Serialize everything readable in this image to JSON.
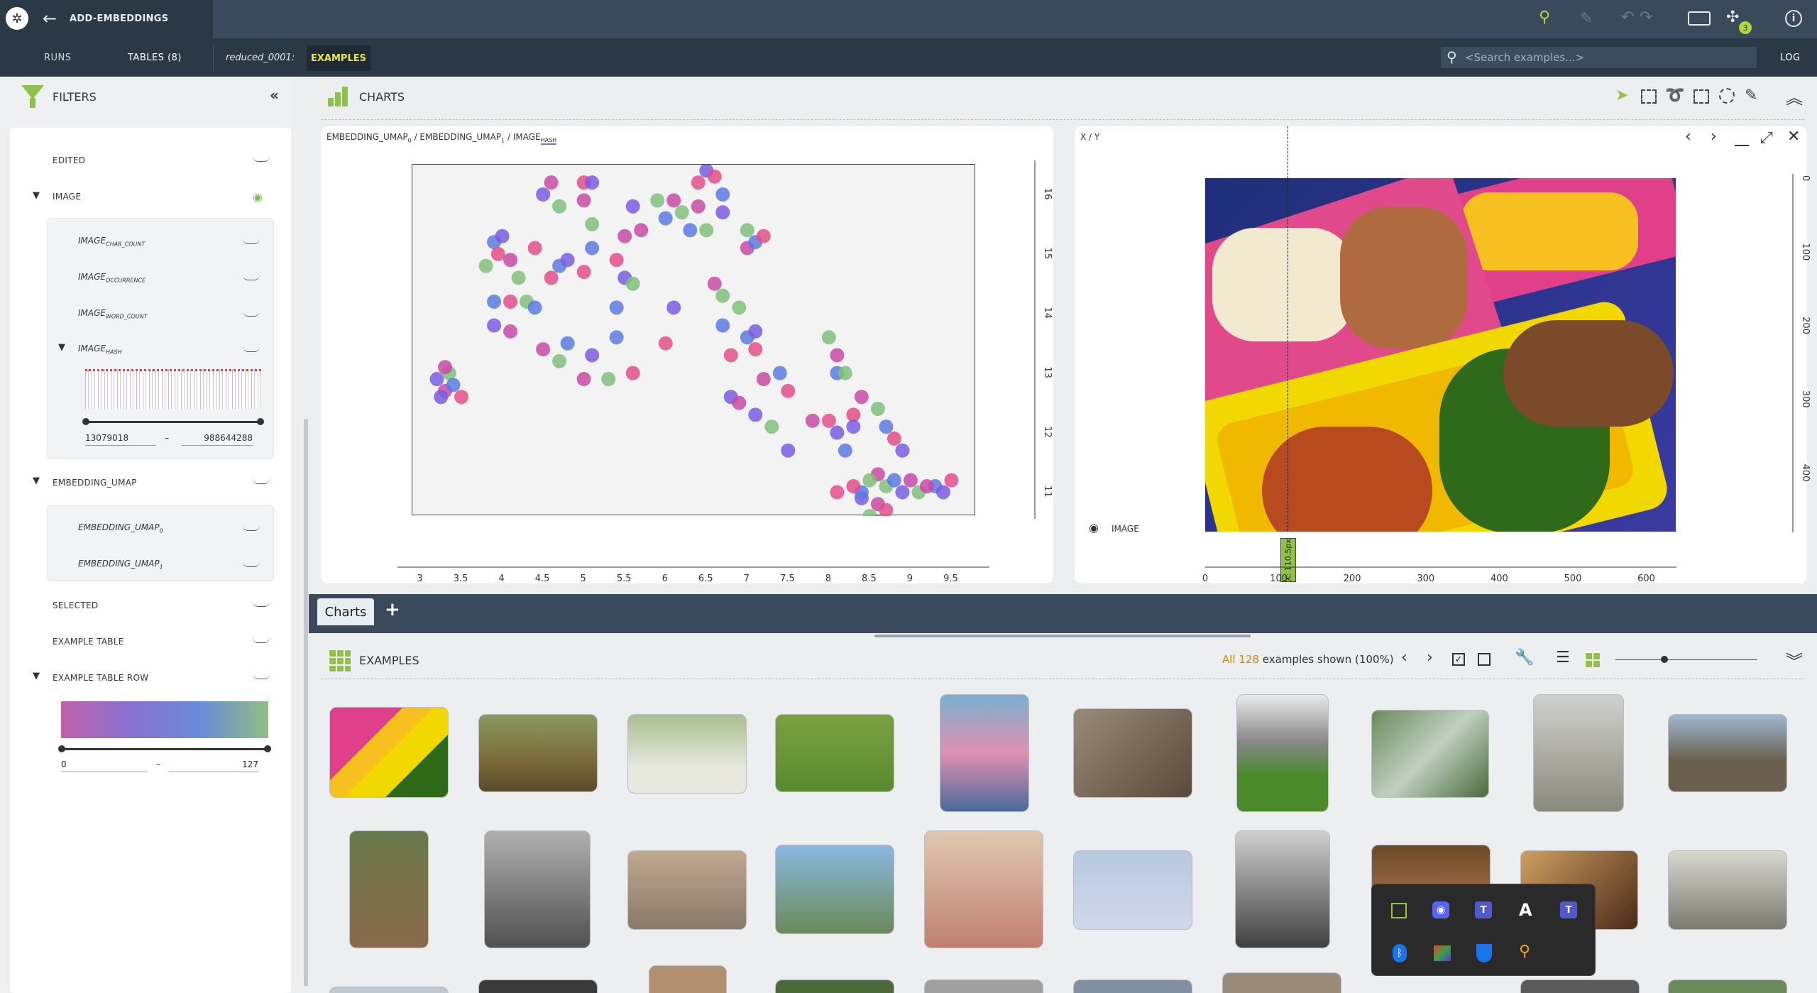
{
  "app": {
    "title": "ADD-EMBEDDINGS",
    "notif_count": "3"
  },
  "nav": {
    "runs": "RUNS",
    "tables": "TABLES (8)",
    "dataset": "reduced_0001:",
    "examples": "EXAMPLES",
    "search_placeholder": "<Search examples...>",
    "log": "LOG"
  },
  "filters": {
    "title": "FILTERS",
    "edited": "EDITED",
    "image": "IMAGE",
    "image_char_count": "IMAGE",
    "image_char_count_sub": "CHAR_COUNT",
    "image_occurrence": "IMAGE",
    "image_occurrence_sub": "OCCURRENCE",
    "image_word_count": "IMAGE",
    "image_word_count_sub": "WORD_COUNT",
    "image_hash": "IMAGE",
    "image_hash_sub": "HASH",
    "hash_min": "13079018",
    "hash_max": "988644288",
    "range_sep": "–",
    "embedding_umap": "EMBEDDING_UMAP",
    "embedding_umap0": "EMBEDDING_UMAP",
    "embedding_umap0_sub": "0",
    "embedding_umap1": "EMBEDDING_UMAP",
    "embedding_umap1_sub": "1",
    "selected": "SELECTED",
    "example_table": "EXAMPLE TABLE",
    "example_table_row": "EXAMPLE TABLE ROW",
    "row_min": "0",
    "row_max": "127"
  },
  "charts": {
    "title": "CHARTS",
    "scatter_title_a": "EMBEDDING_UMAP",
    "scatter_title_a_sub": "0",
    "scatter_title_b": "/ EMBEDDING_UMAP",
    "scatter_title_b_sub": "1",
    "scatter_title_c": "/ IMAGE",
    "scatter_title_c_sub": "HASH",
    "xy_title": "X / Y",
    "image_label": "IMAGE",
    "cursor_label": "X: 110.5px",
    "tab_label": "Charts",
    "add_label": "+"
  },
  "chart_data": {
    "type": "scatter",
    "xlim": [
      2.9,
      9.8
    ],
    "ylim": [
      10.6,
      16.5
    ],
    "x_ticks": [
      "3",
      "3.5",
      "4",
      "4.5",
      "5",
      "5.5",
      "6",
      "6.5",
      "7",
      "7.5",
      "8",
      "8.5",
      "9",
      "9.5"
    ],
    "y_ticks": [
      "11",
      "12",
      "13",
      "14",
      "15",
      "16"
    ],
    "colors": [
      "#7b5ce0",
      "#c84aa3",
      "#7fbf7a",
      "#5a7be0",
      "#e0508a"
    ],
    "points": [
      [
        3.2,
        12.9
      ],
      [
        3.3,
        12.7
      ],
      [
        3.35,
        13.0
      ],
      [
        3.4,
        12.8
      ],
      [
        3.5,
        12.6
      ],
      [
        3.25,
        12.6
      ],
      [
        3.3,
        13.1
      ],
      [
        3.8,
        14.8
      ],
      [
        3.9,
        15.2
      ],
      [
        3.95,
        15.0
      ],
      [
        4.0,
        15.3
      ],
      [
        4.1,
        14.9
      ],
      [
        4.2,
        14.6
      ],
      [
        3.9,
        14.2
      ],
      [
        4.1,
        14.2
      ],
      [
        3.9,
        13.8
      ],
      [
        4.1,
        13.7
      ],
      [
        4.3,
        14.2
      ],
      [
        4.4,
        14.1
      ],
      [
        4.4,
        15.1
      ],
      [
        4.5,
        16.0
      ],
      [
        4.6,
        16.2
      ],
      [
        4.7,
        15.8
      ],
      [
        4.7,
        14.8
      ],
      [
        4.6,
        14.6
      ],
      [
        4.8,
        14.9
      ],
      [
        4.5,
        13.4
      ],
      [
        4.7,
        13.2
      ],
      [
        4.8,
        13.5
      ],
      [
        5.0,
        16.2
      ],
      [
        5.1,
        16.2
      ],
      [
        5.0,
        15.9
      ],
      [
        5.1,
        15.5
      ],
      [
        5.1,
        15.1
      ],
      [
        5.0,
        14.7
      ],
      [
        5.1,
        13.3
      ],
      [
        5.0,
        12.9
      ],
      [
        5.3,
        12.9
      ],
      [
        5.4,
        13.6
      ],
      [
        5.4,
        14.9
      ],
      [
        5.5,
        14.6
      ],
      [
        5.5,
        15.3
      ],
      [
        5.6,
        14.5
      ],
      [
        5.4,
        14.1
      ],
      [
        5.6,
        13.0
      ],
      [
        5.6,
        15.8
      ],
      [
        5.7,
        15.4
      ],
      [
        5.9,
        15.9
      ],
      [
        6.0,
        15.6
      ],
      [
        6.0,
        13.5
      ],
      [
        6.1,
        14.1
      ],
      [
        6.1,
        15.9
      ],
      [
        6.2,
        15.7
      ],
      [
        6.3,
        15.4
      ],
      [
        6.4,
        16.2
      ],
      [
        6.5,
        16.4
      ],
      [
        6.4,
        15.8
      ],
      [
        6.5,
        15.4
      ],
      [
        6.7,
        16.0
      ],
      [
        6.6,
        16.3
      ],
      [
        6.7,
        15.7
      ],
      [
        6.6,
        14.5
      ],
      [
        6.7,
        14.3
      ],
      [
        6.7,
        13.8
      ],
      [
        6.8,
        13.3
      ],
      [
        6.8,
        12.6
      ],
      [
        6.9,
        12.5
      ],
      [
        6.9,
        14.1
      ],
      [
        7.0,
        13.6
      ],
      [
        7.1,
        13.4
      ],
      [
        7.1,
        13.7
      ],
      [
        7.0,
        15.1
      ],
      [
        7.0,
        15.4
      ],
      [
        7.1,
        15.2
      ],
      [
        7.2,
        15.3
      ],
      [
        7.1,
        12.3
      ],
      [
        7.2,
        12.9
      ],
      [
        7.3,
        12.1
      ],
      [
        7.4,
        13.0
      ],
      [
        7.5,
        12.7
      ],
      [
        7.5,
        11.7
      ],
      [
        7.8,
        12.2
      ],
      [
        8.0,
        13.6
      ],
      [
        8.1,
        13.0
      ],
      [
        8.0,
        12.2
      ],
      [
        8.1,
        12.0
      ],
      [
        8.1,
        13.3
      ],
      [
        8.2,
        13.0
      ],
      [
        8.2,
        11.7
      ],
      [
        8.3,
        12.3
      ],
      [
        8.3,
        12.1
      ],
      [
        8.4,
        12.6
      ],
      [
        8.6,
        12.4
      ],
      [
        8.7,
        12.1
      ],
      [
        8.8,
        11.9
      ],
      [
        8.9,
        11.7
      ],
      [
        8.6,
        11.3
      ],
      [
        8.7,
        11.1
      ],
      [
        8.8,
        11.2
      ],
      [
        8.1,
        11.0
      ],
      [
        8.4,
        10.9
      ],
      [
        8.6,
        10.8
      ],
      [
        8.5,
        10.6
      ],
      [
        8.6,
        10.5
      ],
      [
        8.7,
        10.7
      ],
      [
        8.9,
        11.0
      ],
      [
        9.0,
        11.2
      ],
      [
        9.1,
        11.0
      ],
      [
        9.3,
        11.1
      ],
      [
        9.5,
        11.2
      ],
      [
        9.4,
        11.0
      ],
      [
        9.2,
        11.1
      ],
      [
        8.5,
        11.2
      ],
      [
        8.4,
        11.0
      ],
      [
        8.3,
        11.1
      ]
    ]
  },
  "xy_axes": {
    "x_ticks": [
      "0",
      "100",
      "200",
      "300",
      "400",
      "500",
      "600"
    ],
    "y_ticks": [
      "0",
      "100",
      "200",
      "300",
      "400"
    ]
  },
  "examples": {
    "title": "EXAMPLES",
    "count_all": "All 128",
    "count_rest": "examples shown (100%)"
  },
  "taskbar": {
    "icons": [
      "gpu-icon",
      "discord-icon",
      "teams-icon",
      "autocad-icon",
      "teams-icon",
      "bluetooth-icon",
      "monitor-icon",
      "defender-icon",
      "search-tool-icon"
    ]
  }
}
